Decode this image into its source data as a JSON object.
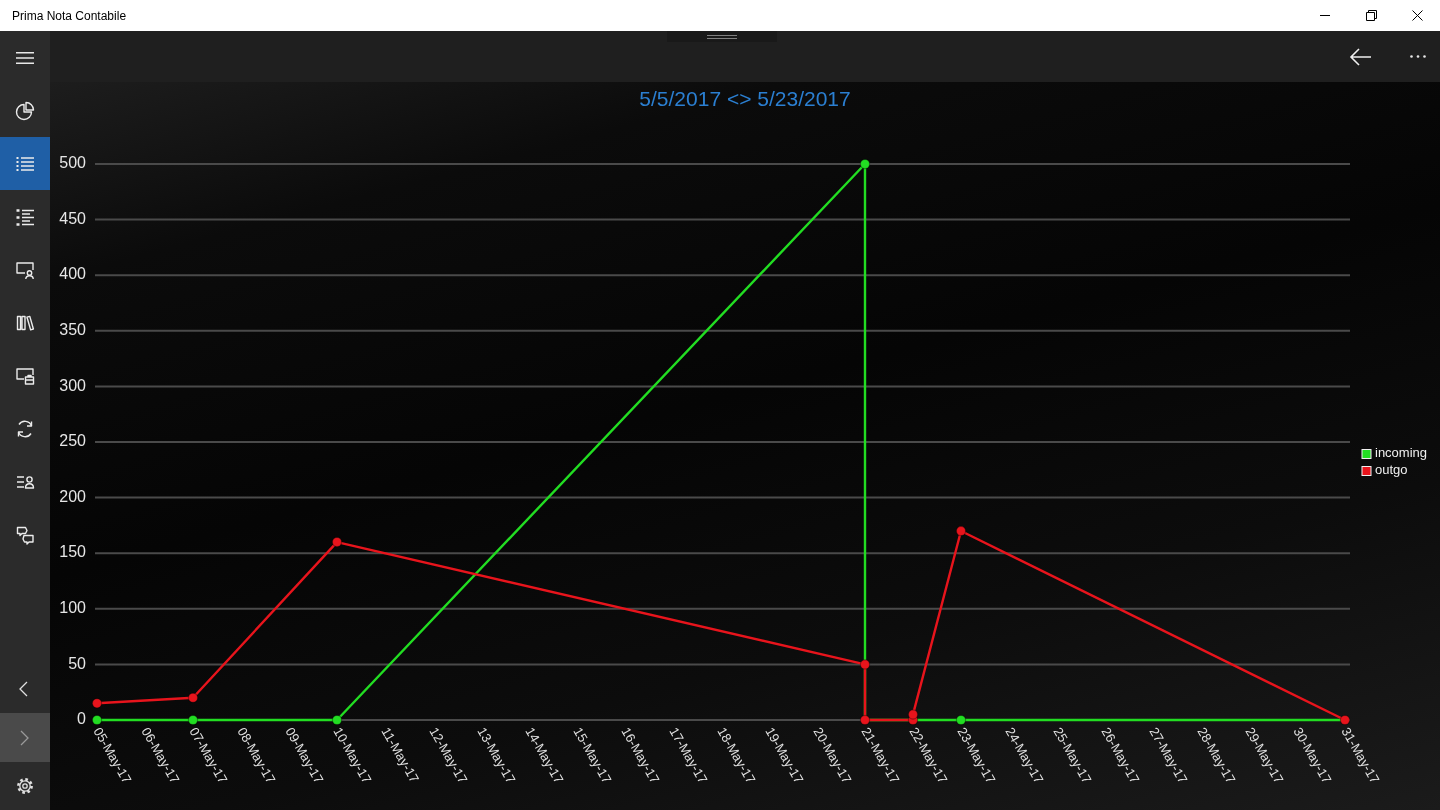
{
  "window": {
    "title": "Prima Nota Contabile"
  },
  "sidebar": {
    "items": [
      {
        "selected": false
      },
      {
        "selected": true
      },
      {
        "selected": false
      },
      {
        "selected": false
      },
      {
        "selected": false
      },
      {
        "selected": false
      },
      {
        "selected": false
      },
      {
        "selected": false
      },
      {
        "selected": false
      }
    ],
    "footer_buttons": [
      {
        "highlighted": false
      },
      {
        "highlighted": true
      },
      {
        "highlighted": false
      }
    ]
  },
  "main": {
    "chart_data": [
      {
        "type": "line",
        "title": "5/5/2017 <> 5/23/2017",
        "xlim": [
          "2017-05-05",
          "2017-05-31"
        ],
        "ylim": [
          0,
          500
        ],
        "yticks": [
          0,
          50,
          100,
          150,
          200,
          250,
          300,
          350,
          400,
          450,
          500
        ],
        "xticks": [
          {
            "value": "2017-05-05",
            "label": "05-May-17"
          },
          {
            "value": "2017-05-06",
            "label": "06-May-17"
          },
          {
            "value": "2017-05-07",
            "label": "07-May-17"
          },
          {
            "value": "2017-05-08",
            "label": "08-May-17"
          },
          {
            "value": "2017-05-09",
            "label": "09-May-17"
          },
          {
            "value": "2017-05-10",
            "label": "10-May-17"
          },
          {
            "value": "2017-05-11",
            "label": "11-May-17"
          },
          {
            "value": "2017-05-12",
            "label": "12-May-17"
          },
          {
            "value": "2017-05-13",
            "label": "13-May-17"
          },
          {
            "value": "2017-05-14",
            "label": "14-May-17"
          },
          {
            "value": "2017-05-15",
            "label": "15-May-17"
          },
          {
            "value": "2017-05-16",
            "label": "16-May-17"
          },
          {
            "value": "2017-05-17",
            "label": "17-May-17"
          },
          {
            "value": "2017-05-18",
            "label": "18-May-17"
          },
          {
            "value": "2017-05-19",
            "label": "19-May-17"
          },
          {
            "value": "2017-05-20",
            "label": "20-May-17"
          },
          {
            "value": "2017-05-21",
            "label": "21-May-17"
          },
          {
            "value": "2017-05-22",
            "label": "22-May-17"
          },
          {
            "value": "2017-05-23",
            "label": "23-May-17"
          },
          {
            "value": "2017-05-24",
            "label": "24-May-17"
          },
          {
            "value": "2017-05-25",
            "label": "25-May-17"
          },
          {
            "value": "2017-05-26",
            "label": "26-May-17"
          },
          {
            "value": "2017-05-27",
            "label": "27-May-17"
          },
          {
            "value": "2017-05-28",
            "label": "28-May-17"
          },
          {
            "value": "2017-05-29",
            "label": "29-May-17"
          },
          {
            "value": "2017-05-30",
            "label": "30-May-17"
          },
          {
            "value": "2017-05-31",
            "label": "31-May-17"
          }
        ],
        "grid": "y",
        "legend": "right",
        "marker": "circle",
        "series": [
          {
            "name": "incoming",
            "color": "#22dd22",
            "x": [
              "2017-05-05",
              "2017-05-07",
              "2017-05-10",
              "2017-05-21",
              "2017-05-21",
              "2017-05-22",
              "2017-05-23",
              "2017-05-31"
            ],
            "values": [
              0,
              0,
              0,
              500,
              0,
              0,
              0,
              0
            ]
          },
          {
            "name": "outgo",
            "color": "#e8141c",
            "x": [
              "2017-05-05",
              "2017-05-07",
              "2017-05-10",
              "2017-05-21",
              "2017-05-21",
              "2017-05-22",
              "2017-05-22",
              "2017-05-23",
              "2017-05-31"
            ],
            "values": [
              15,
              20,
              160,
              50,
              0,
              0,
              5,
              170,
              0
            ]
          }
        ]
      }
    ]
  }
}
